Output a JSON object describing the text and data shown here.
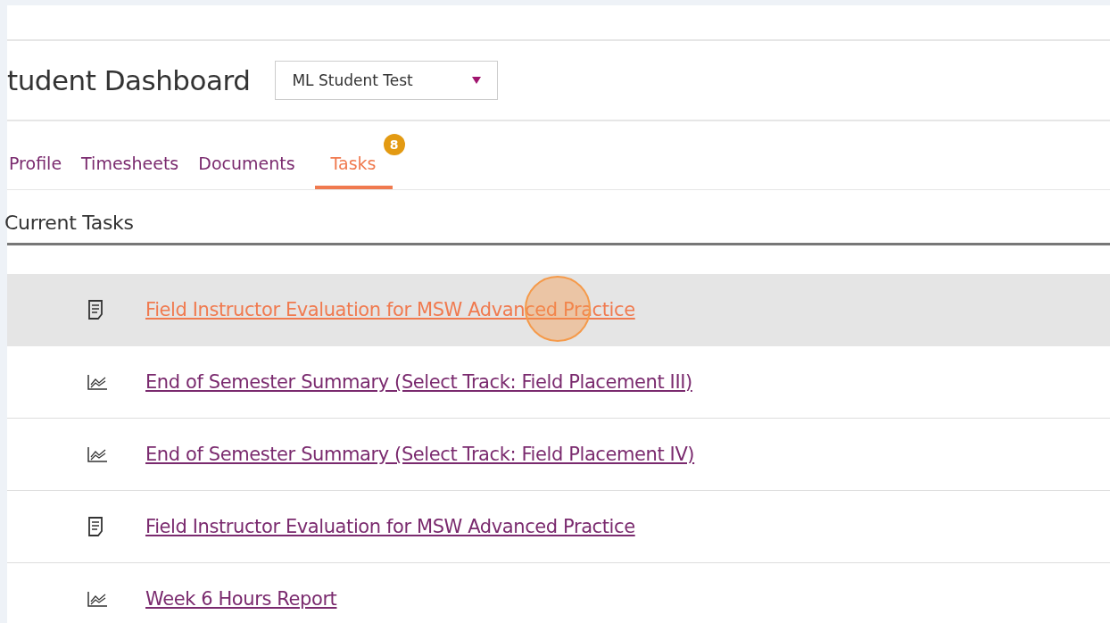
{
  "header": {
    "title": "tudent Dashboard",
    "student_select": {
      "value": "ML Student Test"
    }
  },
  "tabs": [
    {
      "label": "Profile",
      "selected": false
    },
    {
      "label": "Timesheets",
      "selected": false
    },
    {
      "label": "Documents",
      "selected": false
    },
    {
      "label": "Tasks",
      "selected": true,
      "badge": "8"
    }
  ],
  "section": {
    "title": "Current Tasks"
  },
  "tasks": [
    {
      "kind": "form",
      "title": "Field Instructor Evaluation for MSW Advanced Practice",
      "selected": true
    },
    {
      "kind": "chart",
      "title": "End of Semester Summary (Select Track: Field Placement III)",
      "selected": false
    },
    {
      "kind": "chart",
      "title": "End of Semester Summary (Select Track: Field Placement IV)",
      "selected": false
    },
    {
      "kind": "form",
      "title": "Field Instructor Evaluation for MSW Advanced Practice",
      "selected": false
    },
    {
      "kind": "chart",
      "title": "Week 6 Hours Report",
      "selected": false
    }
  ]
}
